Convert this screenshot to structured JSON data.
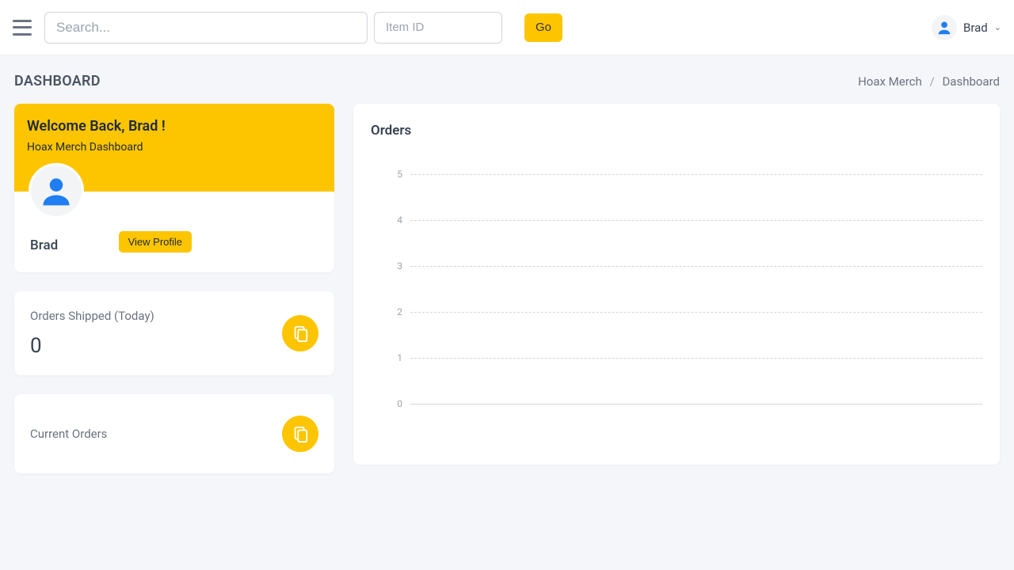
{
  "header": {
    "search_placeholder": "Search...",
    "itemid_placeholder": "Item ID",
    "go_label": "Go",
    "user_name": "Brad"
  },
  "page": {
    "title": "DASHBOARD",
    "breadcrumb_root": "Hoax Merch",
    "breadcrumb_current": "Dashboard"
  },
  "welcome": {
    "title": "Welcome Back, Brad !",
    "subtitle": "Hoax Merch Dashboard",
    "profile_name": "Brad",
    "view_profile_label": "View Profile"
  },
  "stats": {
    "shipped_label": "Orders Shipped (Today)",
    "shipped_value": "0",
    "current_label": "Current Orders"
  },
  "orders": {
    "title": "Orders"
  },
  "chart_data": {
    "type": "line",
    "title": "Orders",
    "xlabel": "",
    "ylabel": "",
    "ylim": [
      0,
      5
    ],
    "y_ticks": [
      0,
      1,
      2,
      3,
      4,
      5
    ],
    "categories": [],
    "series": [
      {
        "name": "Orders",
        "values": []
      }
    ]
  }
}
